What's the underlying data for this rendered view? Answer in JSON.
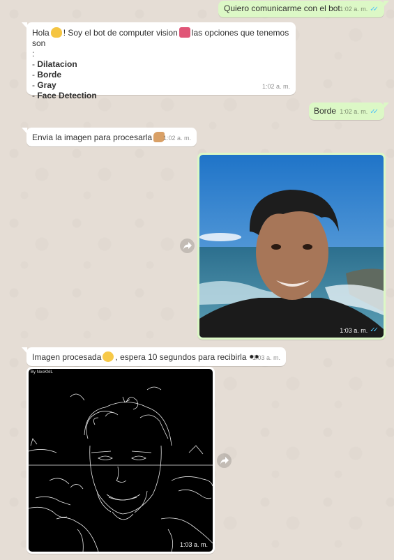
{
  "messages": {
    "m1": {
      "text": "Quiero comunicarme con el bot",
      "time": "1:02 a. m."
    },
    "m2": {
      "greeting_pre": "Hola",
      "greeting_mid": "! Soy el bot de computer vision",
      "greeting_post": "las opciones que tenemos son",
      "colon": ":",
      "options": [
        "Dilatacion",
        "Borde",
        "Gray",
        "Face Detection"
      ],
      "dash": "- ",
      "time": "1:02 a. m."
    },
    "m3": {
      "text": "Borde",
      "time": "1:02 a. m."
    },
    "m4": {
      "text": "Envia la imagen para procesarla",
      "time": "1:02 a. m."
    },
    "m5": {
      "time": "1:03 a. m."
    },
    "m6": {
      "text_pre": "Imagen procesada",
      "text_post": ", espera 10 segundos para recibirla",
      "time": "1:03 a. m."
    },
    "m7": {
      "watermark": "By NeoKML",
      "time": "1:03 a. m."
    }
  },
  "icons": {
    "read_ticks": "double-check-icon",
    "forward": "forward-icon",
    "wave_emoji": "waving-hand-emoji",
    "robot_emoji": "robot-emoji",
    "flex_emoji": "flexed-biceps-emoji",
    "party_emoji": "partying-face-emoji",
    "eyes_emoji": "eyes-emoji"
  },
  "colors": {
    "outgoing_bubble": "#dcf8c6",
    "incoming_bubble": "#ffffff",
    "background": "#e5ddd5",
    "read_ticks": "#4fc3f7"
  }
}
